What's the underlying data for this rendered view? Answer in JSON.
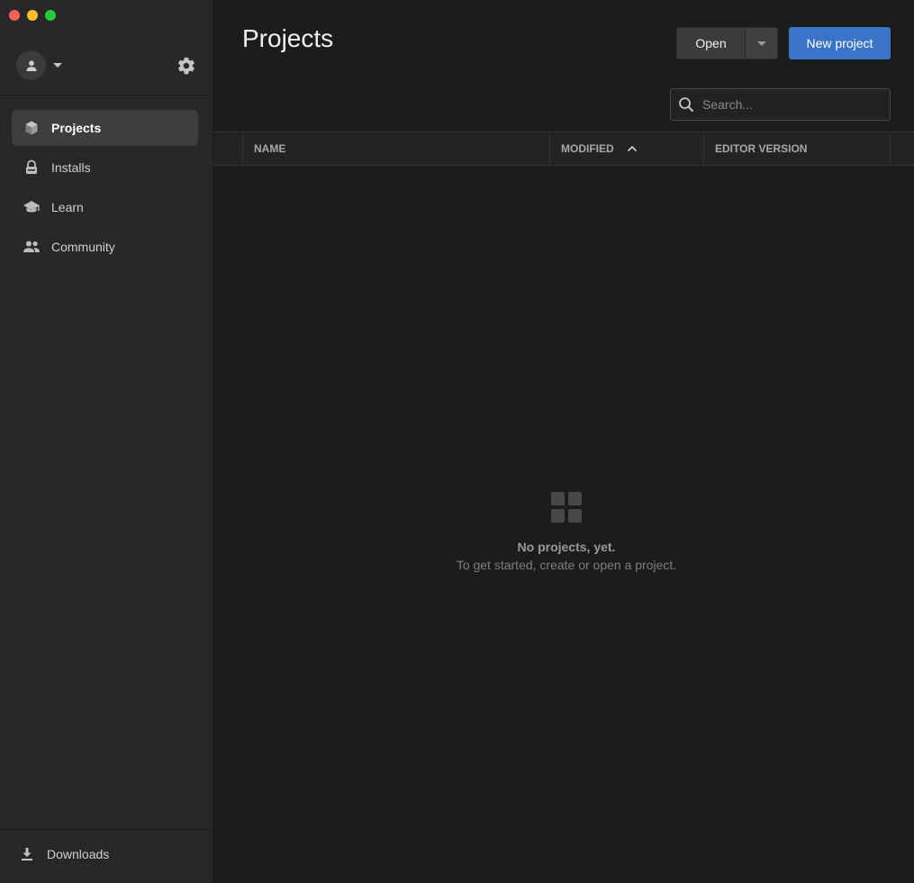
{
  "window": {
    "controls": [
      "close",
      "minimize",
      "maximize"
    ]
  },
  "sidebar": {
    "account_icon": "user-icon",
    "settings_icon": "gear-icon",
    "items": [
      {
        "label": "Projects",
        "icon": "cube-icon",
        "active": true
      },
      {
        "label": "Installs",
        "icon": "lock-icon",
        "active": false
      },
      {
        "label": "Learn",
        "icon": "graduation-cap-icon",
        "active": false
      },
      {
        "label": "Community",
        "icon": "people-icon",
        "active": false
      }
    ],
    "downloads": {
      "label": "Downloads",
      "icon": "download-icon"
    }
  },
  "main": {
    "title": "Projects",
    "open_label": "Open",
    "new_project_label": "New project",
    "search_placeholder": "Search...",
    "columns": {
      "name": "NAME",
      "modified": "MODIFIED",
      "editor_version": "EDITOR VERSION"
    },
    "sort": {
      "column": "modified",
      "direction": "ascending"
    },
    "empty_state": {
      "title": "No projects, yet.",
      "subtitle": "To get started, create or open a project."
    }
  },
  "colors": {
    "accent": "#3a74c8",
    "sidebar_bg": "#282828",
    "main_bg": "#1c1c1c"
  }
}
